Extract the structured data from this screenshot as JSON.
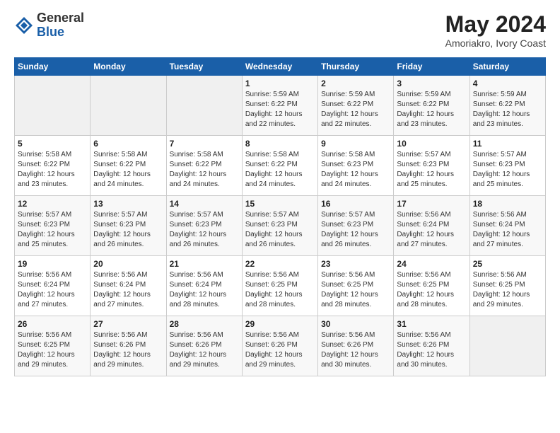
{
  "logo": {
    "general": "General",
    "blue": "Blue"
  },
  "title": "May 2024",
  "location": "Amoriakro, Ivory Coast",
  "days_header": [
    "Sunday",
    "Monday",
    "Tuesday",
    "Wednesday",
    "Thursday",
    "Friday",
    "Saturday"
  ],
  "weeks": [
    [
      {
        "day": "",
        "info": ""
      },
      {
        "day": "",
        "info": ""
      },
      {
        "day": "",
        "info": ""
      },
      {
        "day": "1",
        "info": "Sunrise: 5:59 AM\nSunset: 6:22 PM\nDaylight: 12 hours\nand 22 minutes."
      },
      {
        "day": "2",
        "info": "Sunrise: 5:59 AM\nSunset: 6:22 PM\nDaylight: 12 hours\nand 22 minutes."
      },
      {
        "day": "3",
        "info": "Sunrise: 5:59 AM\nSunset: 6:22 PM\nDaylight: 12 hours\nand 23 minutes."
      },
      {
        "day": "4",
        "info": "Sunrise: 5:59 AM\nSunset: 6:22 PM\nDaylight: 12 hours\nand 23 minutes."
      }
    ],
    [
      {
        "day": "5",
        "info": "Sunrise: 5:58 AM\nSunset: 6:22 PM\nDaylight: 12 hours\nand 23 minutes."
      },
      {
        "day": "6",
        "info": "Sunrise: 5:58 AM\nSunset: 6:22 PM\nDaylight: 12 hours\nand 24 minutes."
      },
      {
        "day": "7",
        "info": "Sunrise: 5:58 AM\nSunset: 6:22 PM\nDaylight: 12 hours\nand 24 minutes."
      },
      {
        "day": "8",
        "info": "Sunrise: 5:58 AM\nSunset: 6:22 PM\nDaylight: 12 hours\nand 24 minutes."
      },
      {
        "day": "9",
        "info": "Sunrise: 5:58 AM\nSunset: 6:23 PM\nDaylight: 12 hours\nand 24 minutes."
      },
      {
        "day": "10",
        "info": "Sunrise: 5:57 AM\nSunset: 6:23 PM\nDaylight: 12 hours\nand 25 minutes."
      },
      {
        "day": "11",
        "info": "Sunrise: 5:57 AM\nSunset: 6:23 PM\nDaylight: 12 hours\nand 25 minutes."
      }
    ],
    [
      {
        "day": "12",
        "info": "Sunrise: 5:57 AM\nSunset: 6:23 PM\nDaylight: 12 hours\nand 25 minutes."
      },
      {
        "day": "13",
        "info": "Sunrise: 5:57 AM\nSunset: 6:23 PM\nDaylight: 12 hours\nand 26 minutes."
      },
      {
        "day": "14",
        "info": "Sunrise: 5:57 AM\nSunset: 6:23 PM\nDaylight: 12 hours\nand 26 minutes."
      },
      {
        "day": "15",
        "info": "Sunrise: 5:57 AM\nSunset: 6:23 PM\nDaylight: 12 hours\nand 26 minutes."
      },
      {
        "day": "16",
        "info": "Sunrise: 5:57 AM\nSunset: 6:23 PM\nDaylight: 12 hours\nand 26 minutes."
      },
      {
        "day": "17",
        "info": "Sunrise: 5:56 AM\nSunset: 6:24 PM\nDaylight: 12 hours\nand 27 minutes."
      },
      {
        "day": "18",
        "info": "Sunrise: 5:56 AM\nSunset: 6:24 PM\nDaylight: 12 hours\nand 27 minutes."
      }
    ],
    [
      {
        "day": "19",
        "info": "Sunrise: 5:56 AM\nSunset: 6:24 PM\nDaylight: 12 hours\nand 27 minutes."
      },
      {
        "day": "20",
        "info": "Sunrise: 5:56 AM\nSunset: 6:24 PM\nDaylight: 12 hours\nand 27 minutes."
      },
      {
        "day": "21",
        "info": "Sunrise: 5:56 AM\nSunset: 6:24 PM\nDaylight: 12 hours\nand 28 minutes."
      },
      {
        "day": "22",
        "info": "Sunrise: 5:56 AM\nSunset: 6:25 PM\nDaylight: 12 hours\nand 28 minutes."
      },
      {
        "day": "23",
        "info": "Sunrise: 5:56 AM\nSunset: 6:25 PM\nDaylight: 12 hours\nand 28 minutes."
      },
      {
        "day": "24",
        "info": "Sunrise: 5:56 AM\nSunset: 6:25 PM\nDaylight: 12 hours\nand 28 minutes."
      },
      {
        "day": "25",
        "info": "Sunrise: 5:56 AM\nSunset: 6:25 PM\nDaylight: 12 hours\nand 29 minutes."
      }
    ],
    [
      {
        "day": "26",
        "info": "Sunrise: 5:56 AM\nSunset: 6:25 PM\nDaylight: 12 hours\nand 29 minutes."
      },
      {
        "day": "27",
        "info": "Sunrise: 5:56 AM\nSunset: 6:26 PM\nDaylight: 12 hours\nand 29 minutes."
      },
      {
        "day": "28",
        "info": "Sunrise: 5:56 AM\nSunset: 6:26 PM\nDaylight: 12 hours\nand 29 minutes."
      },
      {
        "day": "29",
        "info": "Sunrise: 5:56 AM\nSunset: 6:26 PM\nDaylight: 12 hours\nand 29 minutes."
      },
      {
        "day": "30",
        "info": "Sunrise: 5:56 AM\nSunset: 6:26 PM\nDaylight: 12 hours\nand 30 minutes."
      },
      {
        "day": "31",
        "info": "Sunrise: 5:56 AM\nSunset: 6:26 PM\nDaylight: 12 hours\nand 30 minutes."
      },
      {
        "day": "",
        "info": ""
      }
    ]
  ]
}
